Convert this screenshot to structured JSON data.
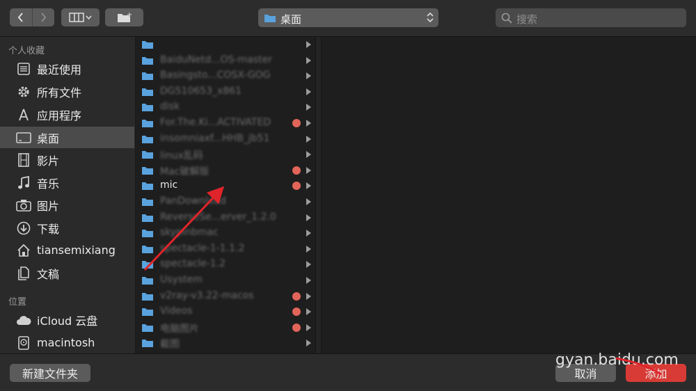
{
  "toolbar": {
    "back_icon": "chevron-left-icon",
    "forward_icon": "chevron-right-icon",
    "view_icon": "column-view-icon",
    "new_folder_icon": "new-folder-icon",
    "location": "桌面",
    "search_placeholder": "搜索"
  },
  "sidebar": {
    "favorites_header": "个人收藏",
    "locations_header": "位置",
    "favorites": [
      {
        "label": "最近使用",
        "icon": "recents-icon"
      },
      {
        "label": "所有文件",
        "icon": "gear-icon"
      },
      {
        "label": "应用程序",
        "icon": "applications-icon"
      },
      {
        "label": "桌面",
        "icon": "desktop-icon",
        "selected": true
      },
      {
        "label": "影片",
        "icon": "film-icon"
      },
      {
        "label": "音乐",
        "icon": "music-icon"
      },
      {
        "label": "图片",
        "icon": "camera-icon"
      },
      {
        "label": "下载",
        "icon": "download-icon"
      },
      {
        "label": "tiansemixiang",
        "icon": "home-icon"
      },
      {
        "label": "文稿",
        "icon": "document-icon"
      }
    ],
    "locations": [
      {
        "label": "iCloud 云盘",
        "icon": "cloud-icon"
      },
      {
        "label": "macintosh",
        "icon": "disk-icon"
      }
    ]
  },
  "files": [
    {
      "name": "",
      "blurred": true,
      "tag": false
    },
    {
      "name": "BaiduNetd...OS-master",
      "blurred": true,
      "tag": false
    },
    {
      "name": "Basingsto...COSX-GOG",
      "blurred": true,
      "tag": false
    },
    {
      "name": "DG510653_x861",
      "blurred": true,
      "tag": false
    },
    {
      "name": "disk",
      "blurred": true,
      "tag": false
    },
    {
      "name": "For.The.Ki...ACTIVATED",
      "blurred": true,
      "tag": true
    },
    {
      "name": "insomniaxf...HHB_jb51",
      "blurred": true,
      "tag": false
    },
    {
      "name": "linux乱码",
      "blurred": true,
      "tag": false
    },
    {
      "name": "Mac破解版",
      "blurred": true,
      "tag": true
    },
    {
      "name": "mic",
      "blurred": false,
      "tag": true
    },
    {
      "name": "PanDownload",
      "blurred": true,
      "tag": false
    },
    {
      "name": "ReverseSe...erver_1.2.0",
      "blurred": true,
      "tag": false
    },
    {
      "name": "skypinbmac",
      "blurred": true,
      "tag": false
    },
    {
      "name": "spectacle-1-1.1.2",
      "blurred": true,
      "tag": false
    },
    {
      "name": "spectacle-1.2",
      "blurred": true,
      "tag": false
    },
    {
      "name": "Usystem",
      "blurred": true,
      "tag": false
    },
    {
      "name": "v2ray-v3.22-macos",
      "blurred": true,
      "tag": true
    },
    {
      "name": "Videos",
      "blurred": true,
      "tag": true
    },
    {
      "name": "电脑图片",
      "blurred": true,
      "tag": true
    },
    {
      "name": "截图",
      "blurred": true,
      "tag": false
    }
  ],
  "buttons": {
    "new_folder": "新建文件夹",
    "cancel": "取消",
    "add": "添加"
  },
  "watermark": "gyan.baidu.com",
  "colors": {
    "accent": "#d83b35",
    "folder": "#5aa2dd",
    "tag_red": "#e26559",
    "annotation_arrow": "#e0242b"
  }
}
